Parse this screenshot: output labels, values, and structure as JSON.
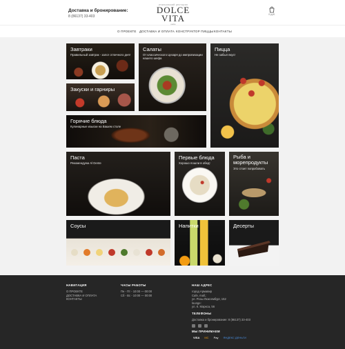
{
  "header": {
    "delivery_label": "Доставка и бронирование:",
    "phone": "8 (86137) 33-403",
    "logo_small": "итальянский ресторан",
    "logo_name": "DOLCE VITA",
    "logo_sub": "кафе",
    "cart_count": "0 руб."
  },
  "nav": [
    {
      "label": "О ПРОЕКТЕ"
    },
    {
      "label": "ДОСТАВКА И ОПЛАТА"
    },
    {
      "label": "КОНСТРУКТОР ПИЦЦЫ"
    },
    {
      "label": "КОНТАКТЫ"
    }
  ],
  "tiles": {
    "zavtraki": {
      "title": "Завтраки",
      "desc": "Правильный завтрак - залог отличного дня!"
    },
    "salaty": {
      "title": "Салаты",
      "desc": "От классического Цезаря до импровизации нашего шефа"
    },
    "pizza": {
      "title": "Пицца",
      "desc": "Не забыл вкус!"
    },
    "zakuski": {
      "title": "Закуски и гарниры",
      "desc": ""
    },
    "goryachie": {
      "title": "Горячие блюда",
      "desc": "Кулинарные изыски на Вашем столе"
    },
    "pasta": {
      "title": "Паста",
      "desc": "Рекомендуем Al Dente"
    },
    "pervye": {
      "title": "Первые блюда",
      "desc": "Хорошо пошли в обед!"
    },
    "ryba": {
      "title": "Рыба и морепродукты",
      "desc": "Это стоит попробовать"
    },
    "sousy": {
      "title": "Соусы",
      "desc": ""
    },
    "napitki": {
      "title": "Напитки",
      "desc": ""
    },
    "deserty": {
      "title": "Десерты",
      "desc": ""
    }
  },
  "footer": {
    "nav_head": "НАВИГАЦИЯ",
    "nav_items": [
      "О ПРОЕКТЕ",
      "ДОСТАВКА И ОПЛАТА",
      "КОНТАКТЫ"
    ],
    "hours_head": "ЧАСЫ РАБОТЫ",
    "hours": [
      "Пн - Пт - 10:00 — 00:00",
      "Сб - Вс - 10:00 — 00:00"
    ],
    "addr_head": "НАШ АДРЕС",
    "addr": [
      "город Армавир",
      "Cafe, mall,:",
      "ул. Розы Люксембург, 152",
      "lounge:",
      "ул. К. Маркса, 56"
    ],
    "phones_head": "ТЕЛЕФОНЫ",
    "phones": "Доставка и бронирование: 8 (86137) 33-403",
    "pay_head": "МЫ ПРИНИМАЕМ",
    "pay": [
      "VISA",
      "MC",
      "Pay",
      "ЯНДЕКС ДЕНЬГИ"
    ]
  },
  "colors": {
    "footer_bg": "#262626",
    "page_bg": "#f2f2f2"
  }
}
